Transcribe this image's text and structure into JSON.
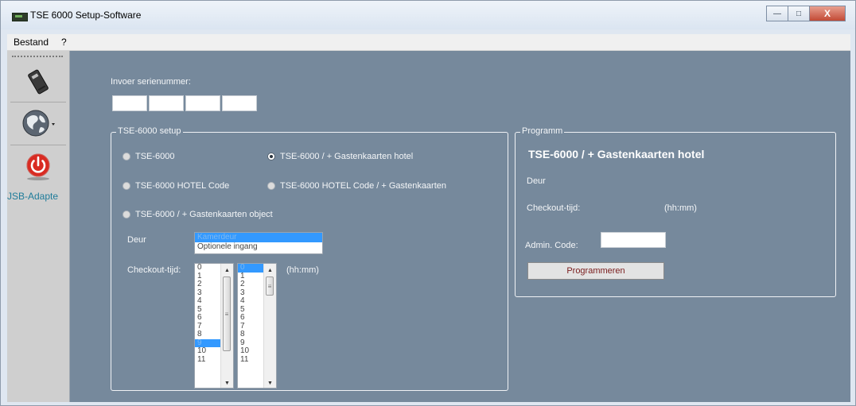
{
  "window": {
    "title": "TSE 6000 Setup-Software"
  },
  "window_controls": {
    "minimize": "—",
    "maximize": "□",
    "close": "X"
  },
  "menu": [
    "Bestand",
    "?"
  ],
  "toolbar": {
    "usb_label": "JSB-Adapte"
  },
  "serial": {
    "label": "Invoer serienummer:",
    "fields": [
      "",
      "",
      "",
      ""
    ]
  },
  "setup": {
    "title": "TSE-6000 setup",
    "options": [
      {
        "label": "TSE-6000",
        "checked": false
      },
      {
        "label": "TSE-6000 / + Gastenkaarten hotel",
        "checked": true
      },
      {
        "label": "TSE-6000 HOTEL Code",
        "checked": false
      },
      {
        "label": "TSE-6000 HOTEL Code / + Gastenkaarten",
        "checked": false
      },
      {
        "label": "TSE-6000 / + Gastenkaarten object",
        "checked": false
      }
    ],
    "deur_label": "Deur",
    "deur_options": [
      "Kamerdeur",
      "Optionele ingang"
    ],
    "checkout_label": "Checkout-tijd:",
    "hours": [
      "0",
      "1",
      "2",
      "3",
      "4",
      "5",
      "6",
      "7",
      "8",
      "9",
      "10",
      "11"
    ],
    "hours_selected": "9",
    "minutes": [
      "0",
      "1",
      "2",
      "3",
      "4",
      "5",
      "6",
      "7",
      "8",
      "9",
      "10",
      "11"
    ],
    "minutes_selected": "0",
    "unit": "(hh:mm)"
  },
  "programm": {
    "title": "Programm",
    "heading": "TSE-6000 / + Gastenkaarten hotel",
    "deur_label": "Deur",
    "checkout_label": "Checkout-tijd:",
    "unit": "(hh:mm)",
    "admin_label": "Admin. Code:",
    "admin_value": "",
    "button": "Programmeren"
  },
  "colors": {
    "panel": "#76899c",
    "selection": "#3399ff",
    "toolbar": "#cfcfcf"
  }
}
